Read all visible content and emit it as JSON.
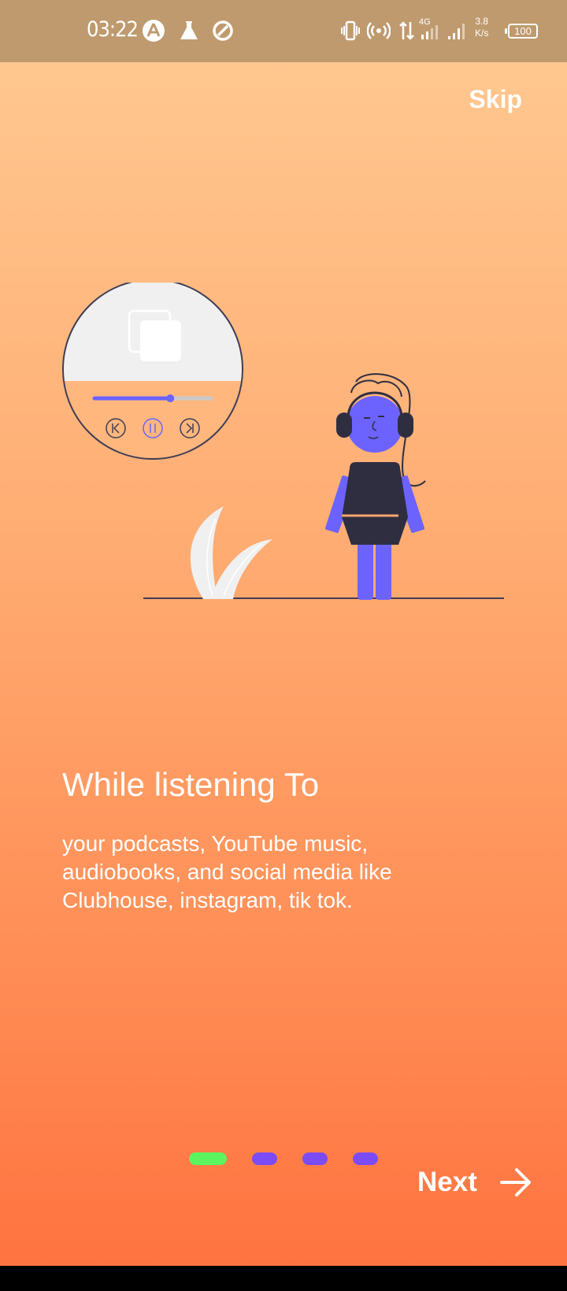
{
  "status_bar": {
    "time": "03:22",
    "left_icons": [
      "app-store-icon",
      "lab-flask-icon",
      "sync-icon"
    ],
    "right_icons": [
      "vibrate-icon",
      "hotspot-icon",
      "data-transfer-icon",
      "signal-icon",
      "signal-icon-2"
    ],
    "network_type": "4G",
    "speed_value": "3.8",
    "speed_unit": "K/s",
    "battery": "100"
  },
  "onboarding": {
    "skip_label": "Skip",
    "title": "While listening To",
    "description": "your podcasts, YouTube music, audiobooks, and social media like Clubhouse, instagram, tik tok.",
    "page_indicator": {
      "total": 4,
      "current": 1
    },
    "next_label": "Next"
  },
  "colors": {
    "status_bar_bg": "#bf9a6e",
    "gradient_top": "#ffc78f",
    "gradient_bottom": "#ff7340",
    "indicator_active": "#5cf560",
    "indicator_inactive": "#7b4cf5",
    "illustration_accent": "#6c63ff",
    "illustration_dark": "#2f2e41"
  },
  "illustration": {
    "player_progress": 0.65
  }
}
